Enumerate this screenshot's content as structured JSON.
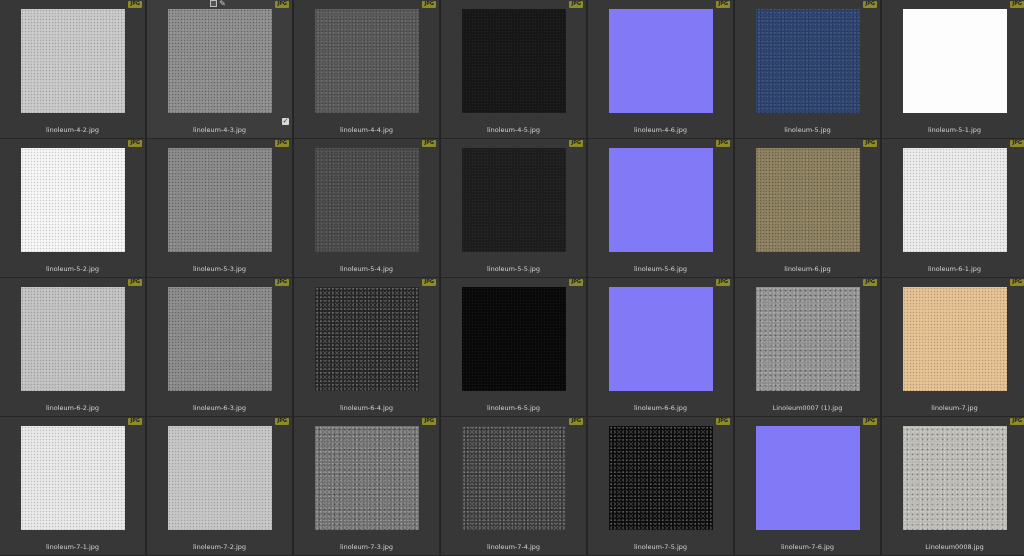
{
  "badge_text": "JPG",
  "selected_tools": {
    "select_icon": "checkbox-square-icon",
    "edit_icon": "pencil-icon",
    "check_icon": "checkmark-icon"
  },
  "items": [
    {
      "name": "linoleum-4-2.jpg",
      "color": "#c9c9c9",
      "noise": "light"
    },
    {
      "name": "linoleum-4-3.jpg",
      "color": "#8f8f8f",
      "noise": "mid",
      "selected": true
    },
    {
      "name": "linoleum-4-4.jpg",
      "color": "#5b5b5b",
      "noise": "mid"
    },
    {
      "name": "linoleum-4-5.jpg",
      "color": "#161616",
      "noise": "dark"
    },
    {
      "name": "linoleum-4-6.jpg",
      "color": "#8279f6",
      "noise": "none"
    },
    {
      "name": "linoleum-5.jpg",
      "color": "#2f4673",
      "noise": "mid"
    },
    {
      "name": "linoleum-5-1.jpg",
      "color": "#fdfdfd",
      "noise": "none"
    },
    {
      "name": "linoleum-5-2.jpg",
      "color": "#f6f6f6",
      "noise": "light"
    },
    {
      "name": "linoleum-5-3.jpg",
      "color": "#8a8a8a",
      "noise": "mid"
    },
    {
      "name": "linoleum-5-4.jpg",
      "color": "#4d4d4d",
      "noise": "mid"
    },
    {
      "name": "linoleum-5-5.jpg",
      "color": "#1c1c1c",
      "noise": "dark"
    },
    {
      "name": "linoleum-5-6.jpg",
      "color": "#8279f6",
      "noise": "none"
    },
    {
      "name": "linoleum-6.jpg",
      "color": "#8e8160",
      "noise": "mid"
    },
    {
      "name": "linoleum-6-1.jpg",
      "color": "#ececec",
      "noise": "light"
    },
    {
      "name": "linoleum-6-2.jpg",
      "color": "#c2c2c2",
      "noise": "light"
    },
    {
      "name": "linoleum-6-3.jpg",
      "color": "#8c8c8c",
      "noise": "mid"
    },
    {
      "name": "linoleum-6-4.jpg",
      "color": "#262626",
      "noise": "speck"
    },
    {
      "name": "linoleum-6-5.jpg",
      "color": "#080808",
      "noise": "dark"
    },
    {
      "name": "linoleum-6-6.jpg",
      "color": "#8279f6",
      "noise": "none"
    },
    {
      "name": "Linoleum0007 (1).jpg",
      "color": "#8d8d8d",
      "noise": "speck"
    },
    {
      "name": "linoleum-7.jpg",
      "color": "#e6c191",
      "noise": "light"
    },
    {
      "name": "linoleum-7-1.jpg",
      "color": "#e9e9e9",
      "noise": "light"
    },
    {
      "name": "linoleum-7-2.jpg",
      "color": "#c6c6c6",
      "noise": "light"
    },
    {
      "name": "linoleum-7-3.jpg",
      "color": "#6f6f6f",
      "noise": "speck"
    },
    {
      "name": "linoleum-7-4.jpg",
      "color": "#3c3c3c",
      "noise": "speck"
    },
    {
      "name": "linoleum-7-5.jpg",
      "color": "#0b0b0b",
      "noise": "speck"
    },
    {
      "name": "linoleum-7-6.jpg",
      "color": "#8279f6",
      "noise": "none"
    },
    {
      "name": "Linoleum0008.jpg",
      "color": "#b9b8b2",
      "noise": "speck"
    }
  ]
}
